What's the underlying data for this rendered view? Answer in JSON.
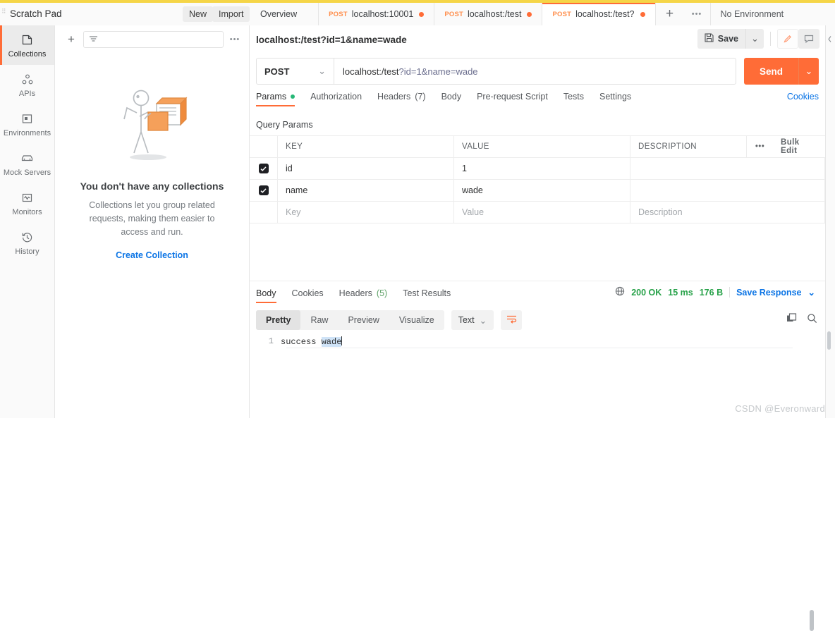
{
  "app": {
    "scratch_pad_title": "Scratch Pad",
    "new_label": "New",
    "import_label": "Import"
  },
  "tabs": {
    "overview_label": "Overview",
    "items": [
      {
        "method": "POST",
        "name": "localhost:10001",
        "unsaved": true,
        "active": false
      },
      {
        "method": "POST",
        "name": "localhost:/test",
        "unsaved": true,
        "active": false
      },
      {
        "method": "POST",
        "name": "localhost:/test?",
        "unsaved": true,
        "active": true
      }
    ],
    "add_label": "+",
    "more_label": "•••"
  },
  "environment": {
    "selected": "No Environment",
    "caret": "⌄"
  },
  "sidebar": {
    "items": [
      {
        "label": "Collections",
        "icon": "collections-icon",
        "active": true
      },
      {
        "label": "APIs",
        "icon": "apis-icon",
        "active": false
      },
      {
        "label": "Environments",
        "icon": "environments-icon",
        "active": false
      },
      {
        "label": "Mock Servers",
        "icon": "mock-servers-icon",
        "active": false
      },
      {
        "label": "Monitors",
        "icon": "monitors-icon",
        "active": false
      },
      {
        "label": "History",
        "icon": "history-icon",
        "active": false
      }
    ]
  },
  "collections_pane": {
    "add_label": "+",
    "filter_placeholder": "",
    "more_label": "•••",
    "empty_title": "You don't have any collections",
    "empty_desc": "Collections let you group related requests, making them easier to access and run.",
    "create_link": "Create Collection"
  },
  "request": {
    "title": "localhost:/test?id=1&name=wade",
    "save_label": "Save",
    "save_caret": "⌄",
    "method": "POST",
    "method_caret": "⌄",
    "url_base": "localhost:/test",
    "url_query": "?id=1&name=wade",
    "url_full": "localhost:/test?id=1&name=wade",
    "send_label": "Send",
    "send_caret": "⌄",
    "tabs": [
      {
        "label": "Params",
        "active": true,
        "dot": true
      },
      {
        "label": "Authorization",
        "active": false
      },
      {
        "label": "Headers",
        "count": "(7)",
        "active": false
      },
      {
        "label": "Body",
        "active": false
      },
      {
        "label": "Pre-request Script",
        "active": false
      },
      {
        "label": "Tests",
        "active": false
      },
      {
        "label": "Settings",
        "active": false
      }
    ],
    "cookies_link": "Cookies",
    "query_params_label": "Query Params",
    "table": {
      "headers": [
        "KEY",
        "VALUE",
        "DESCRIPTION"
      ],
      "more_label": "•••",
      "bulk_edit_label": "Bulk Edit",
      "rows": [
        {
          "checked": true,
          "key": "id",
          "value": "1",
          "description": ""
        },
        {
          "checked": true,
          "key": "name",
          "value": "wade",
          "description": ""
        }
      ],
      "placeholder_row": {
        "key": "Key",
        "value": "Value",
        "description": "Description"
      }
    }
  },
  "response": {
    "tabs": [
      {
        "label": "Body",
        "active": true
      },
      {
        "label": "Cookies",
        "active": false
      },
      {
        "label": "Headers",
        "count": "(5)",
        "active": false
      },
      {
        "label": "Test Results",
        "active": false
      }
    ],
    "status_code": "200 OK",
    "time": "15 ms",
    "size": "176 B",
    "save_response_label": "Save Response",
    "save_response_caret": "⌄",
    "format_tabs": [
      {
        "label": "Pretty",
        "active": true
      },
      {
        "label": "Raw",
        "active": false
      },
      {
        "label": "Preview",
        "active": false
      },
      {
        "label": "Visualize",
        "active": false
      }
    ],
    "type_label": "Text",
    "type_caret": "⌄",
    "body_line_number": "1",
    "body_text_plain": "success ",
    "body_text_selected": "wade"
  },
  "watermark": "CSDN @Everonward",
  "colors": {
    "accent": "#ff6c37",
    "link": "#0b74e5",
    "success": "#26a148",
    "dot_green": "#26b776",
    "scratch_strip": "#f5d547"
  }
}
